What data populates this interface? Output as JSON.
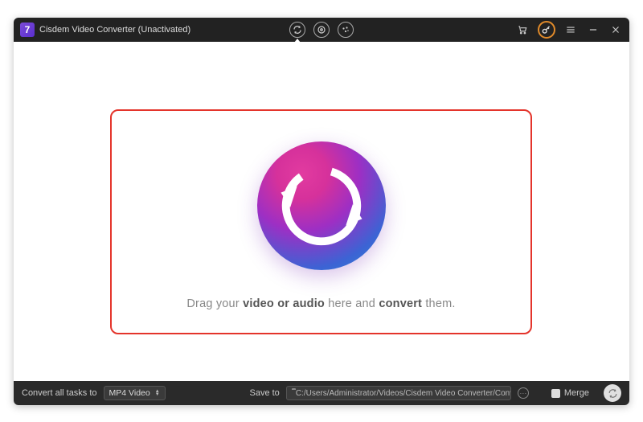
{
  "titlebar": {
    "appName": "Cisdem Video Converter (Unactivated)",
    "logoGlyph": "7"
  },
  "dropzone": {
    "text_pre": "Drag your ",
    "text_bold1": "video or audio",
    "text_mid": " here and ",
    "text_bold2": "convert",
    "text_post": " them."
  },
  "bottom": {
    "convertLabel": "Convert all tasks to",
    "formatSelected": "MP4 Video",
    "saveLabel": "Save to",
    "savePath": "C:/Users/Administrator/Videos/Cisdem Video Converter/Converted",
    "mergeLabel": "Merge"
  }
}
